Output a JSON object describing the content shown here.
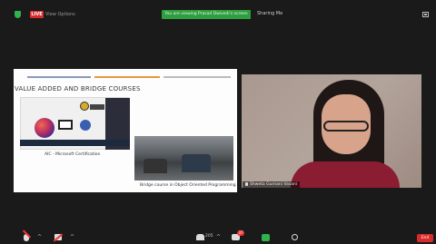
{
  "topbar": {
    "live_label": "LIVE",
    "view_options_label": "View Options",
    "share_banner": "You are viewing Prasad Dwivedi's screen",
    "sharing_menu_label": "Sharing Me"
  },
  "slide": {
    "title": "VALUE ADDED AND BRIDGE COURSES",
    "bar_colors": [
      "#8a9ab5",
      "#e69a38",
      "#bcbcbc"
    ],
    "left_caption": "AIC - Microsoft Certification",
    "right_caption": "Bridge course in Object Oriented Programming"
  },
  "video": {
    "participant_name": "Shweta Gurnani Vasani"
  },
  "toolbar": {
    "participants_count": "205",
    "chat_badge": "37",
    "end_label": "End"
  },
  "colors": {
    "live": "#d82b2b",
    "share_banner": "#2e9e3e",
    "end": "#d82b2b"
  }
}
